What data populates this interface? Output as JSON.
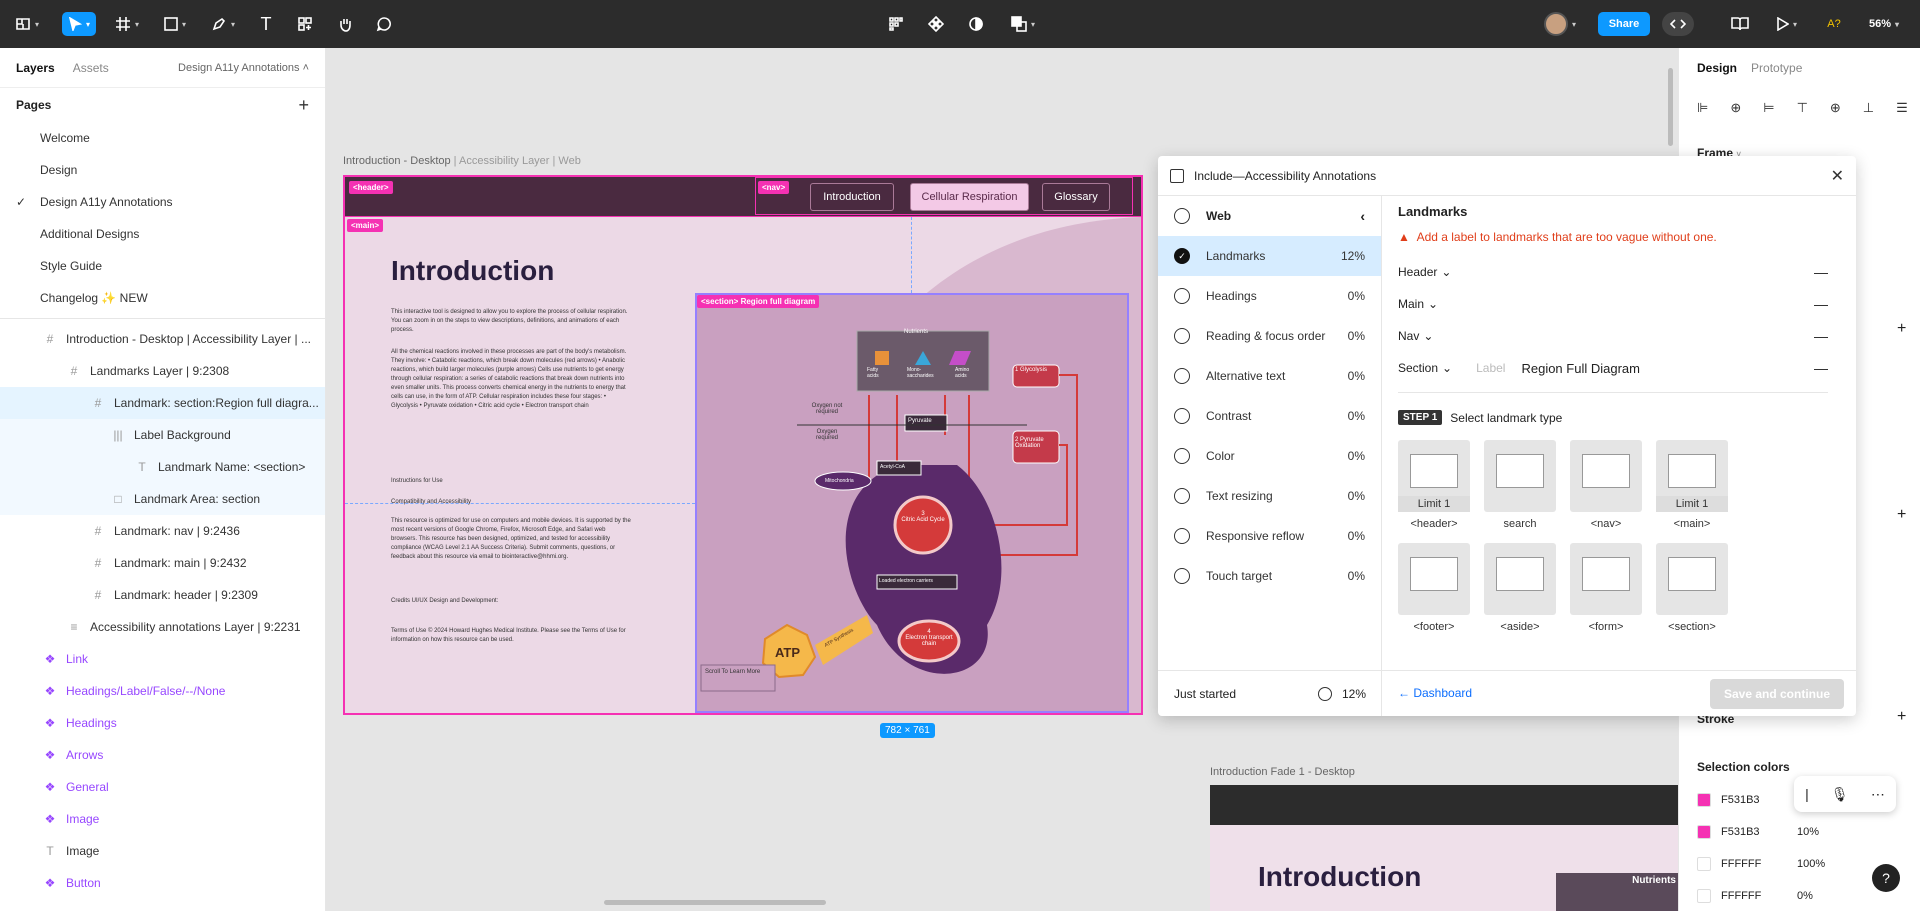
{
  "topbar": {
    "share_label": "Share",
    "zoom": "56%",
    "a11y": "A?"
  },
  "left_panel": {
    "tabs": [
      "Layers",
      "Assets"
    ],
    "file_name": "Design A11y Annotations",
    "pages_title": "Pages",
    "pages": [
      "Welcome",
      "Design",
      "Design A11y Annotations",
      "Additional Designs",
      "Style Guide",
      "Changelog ✨ NEW"
    ],
    "layers": [
      {
        "label": "Introduction - Desktop | Accessibility Layer | ...",
        "icon": "#"
      },
      {
        "label": "Landmarks Layer | 9:2308",
        "icon": "#"
      },
      {
        "label": "Landmark: section:Region full diagra...",
        "icon": "#"
      },
      {
        "label": "Label Background",
        "icon": "|||"
      },
      {
        "label": "Landmark Name: <section>",
        "icon": "T"
      },
      {
        "label": "Landmark Area: section",
        "icon": "□"
      },
      {
        "label": "Landmark: nav | 9:2436",
        "icon": "#"
      },
      {
        "label": "Landmark: main | 9:2432",
        "icon": "#"
      },
      {
        "label": "Landmark: header | 9:2309",
        "icon": "#"
      },
      {
        "label": "Accessibility annotations Layer | 9:2231",
        "icon": "≡"
      },
      {
        "label": "Link",
        "icon": "❖"
      },
      {
        "label": "Headings/Label/False/--/None",
        "icon": "❖"
      },
      {
        "label": "Headings",
        "icon": "❖"
      },
      {
        "label": "Arrows",
        "icon": "❖"
      },
      {
        "label": "General",
        "icon": "❖"
      },
      {
        "label": "Image",
        "icon": "❖"
      },
      {
        "label": "Image",
        "icon": "T"
      },
      {
        "label": "Button",
        "icon": "❖"
      }
    ]
  },
  "canvas": {
    "frame_label": "Introduction - Desktop",
    "frame_label_suffix": " | Accessibility Layer | Web",
    "tags": {
      "header": "<header>",
      "nav": "<nav>",
      "main": "<main>",
      "section": "<section> Region full diagram"
    },
    "nav": [
      "Introduction",
      "Cellular Respiration",
      "Glossary"
    ],
    "heading": "Introduction",
    "body1": "This interactive tool is designed to allow you to explore the process of cellular respiration. You can zoom in on the steps to view descriptions, definitions, and animations of each process.",
    "body2": "All the chemical reactions involved in these processes are part of the body's metabolism. They involve: • Catabolic reactions, which break down molecules (red arrows) • Anabolic reactions, which build larger molecules (purple arrows) Cells use nutrients to get energy through cellular respiration: a series of catabolic reactions that break down nutrients into even smaller units. This process converts chemical energy in the nutrients to energy that cells can use, in the form of ATP. Cellular respiration includes these four stages: • Glycolysis • Pyruvate oxidation • Citric acid cycle • Electron transport chain",
    "body3": "Instructions for Use",
    "body4": "Compatibility and Accessibility",
    "body5": "This resource is optimized for use on computers and mobile devices. It is supported by the most recent versions of Google Chrome, Firefox, Microsoft Edge, and Safari web browsers. This resource has been designed, optimized, and tested for accessibility compliance (WCAG Level 2.1 AA Success Criteria). Submit comments, questions, or feedback about this resource via email to biointeractive@hhmi.org.",
    "body6": "Credits UI/UX Design and Development:",
    "body7": "Terms of Use © 2024 Howard Hughes Medical Institute. Please see the Terms of Use for information on how this resource can be used.",
    "diagram": {
      "nutrients": "Nutrients",
      "n1": "Fatty acids",
      "n2": "Mono-saccharides",
      "n3": "Amino acids",
      "glycolysis": "Glycolysis",
      "pyruvate_ox": "Pyruvate Oxidation",
      "oxygen1": "Oxygen not required",
      "oxygen2": "Oxygen required",
      "pyruvate": "Pyruvate",
      "acetyl": "Acetyl-CoA",
      "mito": "Mitochondria",
      "citric": "Citric Acid Cycle",
      "carriers": "Loaded electron carriers",
      "etc": "Electron transport chain",
      "atp": "ATP",
      "atp_synth": "ATP Synthesis",
      "scroll": "Scroll To Learn More",
      "n_1": "1",
      "n_2": "2",
      "n_3": "3",
      "n_4": "4"
    },
    "size_badge": "782 × 761",
    "fade_label": "Introduction Fade 1 - Desktop",
    "fade_heading": "Introduction",
    "fade_nutrients": "Nutrients"
  },
  "plugin": {
    "title": "Include—Accessibility Annotations",
    "web": "Web",
    "items": [
      {
        "label": "Landmarks",
        "pct": "12%"
      },
      {
        "label": "Headings",
        "pct": "0%"
      },
      {
        "label": "Reading & focus order",
        "pct": "0%"
      },
      {
        "label": "Alternative text",
        "pct": "0%"
      },
      {
        "label": "Contrast",
        "pct": "0%"
      },
      {
        "label": "Color",
        "pct": "0%"
      },
      {
        "label": "Text resizing",
        "pct": "0%"
      },
      {
        "label": "Responsive reflow",
        "pct": "0%"
      },
      {
        "label": "Touch target",
        "pct": "0%"
      }
    ],
    "status": "Just started",
    "status_pct": "12%",
    "heading": "Landmarks",
    "warning": "Add a label to landmarks that are too vague without one.",
    "landmarks": [
      "Header",
      "Main",
      "Nav",
      "Section"
    ],
    "label_placeholder": "Label",
    "label_value": "Region Full Diagram",
    "step_badge": "STEP 1",
    "step_text": "Select landmark type",
    "cards": [
      {
        "cap": "<header>",
        "lim": "Limit 1"
      },
      {
        "cap": "search",
        "lim": ""
      },
      {
        "cap": "<nav>",
        "lim": ""
      },
      {
        "cap": "<main>",
        "lim": "Limit 1"
      },
      {
        "cap": "<footer>",
        "lim": ""
      },
      {
        "cap": "<aside>",
        "lim": ""
      },
      {
        "cap": "<form>",
        "lim": ""
      },
      {
        "cap": "<section>",
        "lim": ""
      }
    ],
    "dashboard": "Dashboard",
    "save": "Save and continue"
  },
  "right_panel": {
    "tabs": [
      "Design",
      "Prototype"
    ],
    "frame": "Frame",
    "stroke": "Stroke",
    "selection_colors": "Selection colors",
    "colors": [
      {
        "hex": "F531B3",
        "pct": "",
        "color": "#f531b3"
      },
      {
        "hex": "F531B3",
        "pct": "10%",
        "color": "#f531b3"
      },
      {
        "hex": "FFFFFF",
        "pct": "100%",
        "color": "#ffffff"
      },
      {
        "hex": "FFFFFF",
        "pct": "0%",
        "color": "#ffffff"
      }
    ]
  }
}
